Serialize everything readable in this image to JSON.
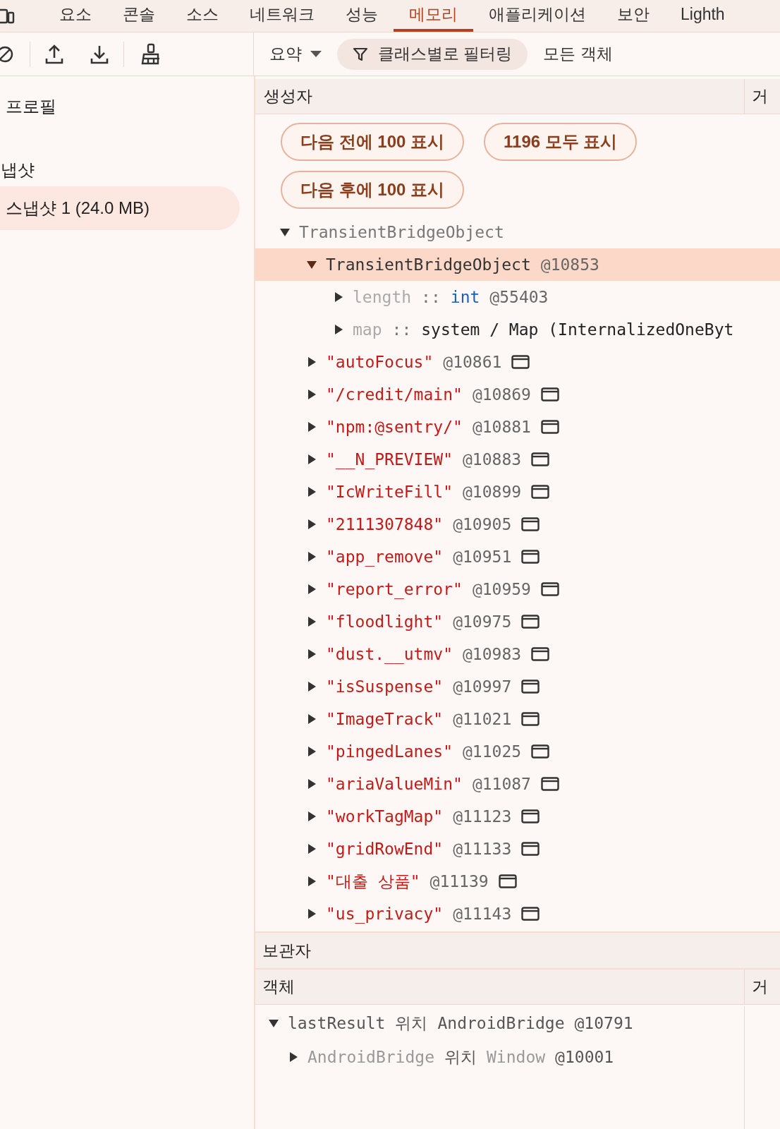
{
  "tabs": [
    {
      "label": "요소",
      "selected": false
    },
    {
      "label": "콘솔",
      "selected": false
    },
    {
      "label": "소스",
      "selected": false
    },
    {
      "label": "네트워크",
      "selected": false
    },
    {
      "label": "성능",
      "selected": false
    },
    {
      "label": "메모리",
      "selected": true
    },
    {
      "label": "애플리케이션",
      "selected": false
    },
    {
      "label": "보안",
      "selected": false
    },
    {
      "label": "Lighth",
      "selected": false
    }
  ],
  "toolbar": {
    "view_select": "요약",
    "filter": "클래스별로 필터링",
    "scope": "모든 객체"
  },
  "sidebar": {
    "heading": "프로필",
    "section": "냅샷",
    "items": [
      {
        "label": "스냅샷 1 (24.0 MB)",
        "selected": true
      }
    ]
  },
  "constructors": {
    "header": "생성자",
    "column_2": "거",
    "buttons": [
      {
        "label": "다음 전에 100 표시"
      },
      {
        "label": "1196 모두 표시"
      },
      {
        "label": "다음 후에 100 표시"
      }
    ],
    "tree": [
      {
        "kind": "class",
        "name": "TransientBridgeObject",
        "expanded": true,
        "selected": false,
        "children": [
          {
            "kind": "object",
            "name": "TransientBridgeObject",
            "id": "@10853",
            "expanded": true,
            "selected": true,
            "children": [
              {
                "kind": "edge",
                "name": "length",
                "sep": "::",
                "value": "int",
                "is_type": true,
                "id": "@55403",
                "expanded": false,
                "selected": false
              },
              {
                "kind": "edge",
                "name": "map",
                "sep": "::",
                "value": "system / Map (InternalizedOneByt",
                "is_type": false,
                "expanded": false,
                "selected": false
              }
            ]
          },
          {
            "kind": "string",
            "name": "\"autoFocus\"",
            "id": "@10861",
            "expanded": false,
            "selected": false
          },
          {
            "kind": "string",
            "name": "\"/credit/main\"",
            "id": "@10869",
            "expanded": false,
            "selected": false
          },
          {
            "kind": "string",
            "name": "\"npm:@sentry/\"",
            "id": "@10881",
            "expanded": false,
            "selected": false
          },
          {
            "kind": "string",
            "name": "\"__N_PREVIEW\"",
            "id": "@10883",
            "expanded": false,
            "selected": false
          },
          {
            "kind": "string",
            "name": "\"IcWriteFill\"",
            "id": "@10899",
            "expanded": false,
            "selected": false
          },
          {
            "kind": "string",
            "name": "\"2111307848\"",
            "id": "@10905",
            "expanded": false,
            "selected": false
          },
          {
            "kind": "string",
            "name": "\"app_remove\"",
            "id": "@10951",
            "expanded": false,
            "selected": false
          },
          {
            "kind": "string",
            "name": "\"report_error\"",
            "id": "@10959",
            "expanded": false,
            "selected": false
          },
          {
            "kind": "string",
            "name": "\"floodlight\"",
            "id": "@10975",
            "expanded": false,
            "selected": false
          },
          {
            "kind": "string",
            "name": "\"dust.__utmv\"",
            "id": "@10983",
            "expanded": false,
            "selected": false
          },
          {
            "kind": "string",
            "name": "\"isSuspense\"",
            "id": "@10997",
            "expanded": false,
            "selected": false
          },
          {
            "kind": "string",
            "name": "\"ImageTrack\"",
            "id": "@11021",
            "expanded": false,
            "selected": false
          },
          {
            "kind": "string",
            "name": "\"pingedLanes\"",
            "id": "@11025",
            "expanded": false,
            "selected": false
          },
          {
            "kind": "string",
            "name": "\"ariaValueMin\"",
            "id": "@11087",
            "expanded": false,
            "selected": false
          },
          {
            "kind": "string",
            "name": "\"workTagMap\"",
            "id": "@11123",
            "expanded": false,
            "selected": false
          },
          {
            "kind": "string",
            "name": "\"gridRowEnd\"",
            "id": "@11133",
            "expanded": false,
            "selected": false
          },
          {
            "kind": "string",
            "name": "\"대출 상품\"",
            "id": "@11139",
            "expanded": false,
            "selected": false
          },
          {
            "kind": "string",
            "name": "\"us_privacy\"",
            "id": "@11143",
            "expanded": false,
            "selected": false
          }
        ]
      }
    ]
  },
  "retainers": {
    "header": "보관자",
    "column_1": "객체",
    "column_2": "거",
    "tree": [
      {
        "name": "lastResult",
        "via": "위치",
        "owner": "AndroidBridge",
        "id": "@10791",
        "expanded": true,
        "children": [
          {
            "name": "AndroidBridge",
            "via": "위치",
            "owner": "Window",
            "id": "@10001",
            "expanded": false
          }
        ]
      }
    ]
  }
}
